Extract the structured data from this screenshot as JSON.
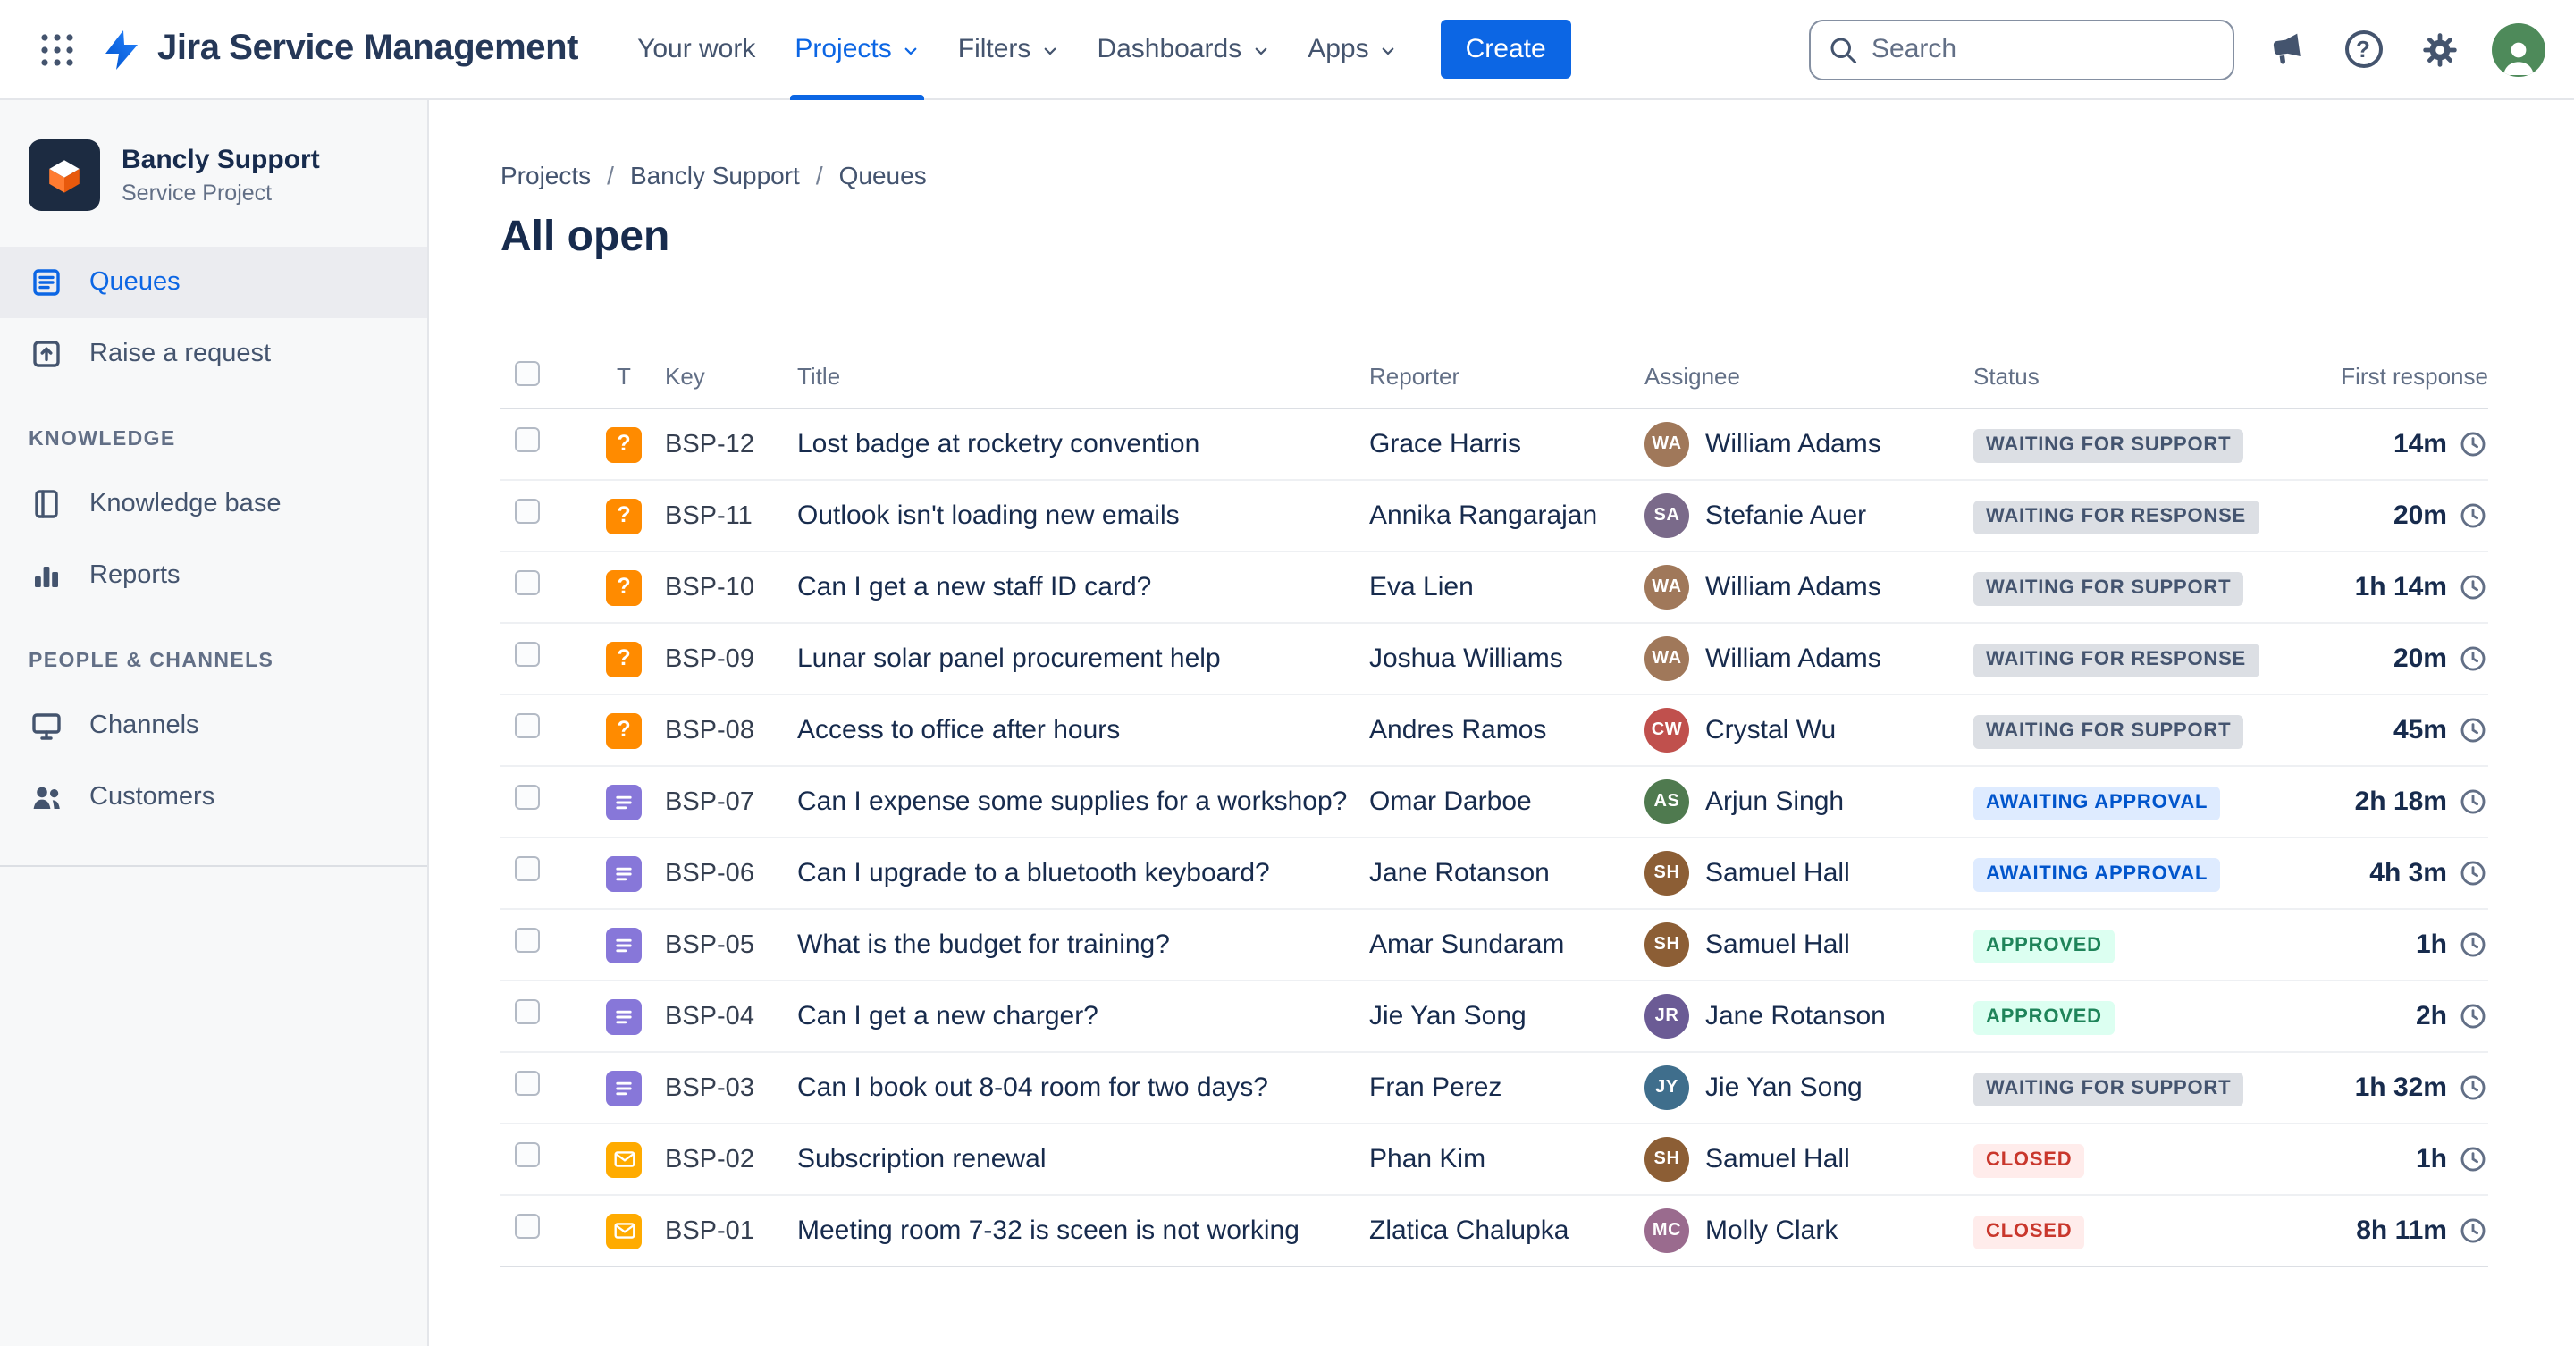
{
  "nav": {
    "app_name": "Jira Service Management",
    "items": [
      {
        "label": "Your work",
        "chevron": false,
        "active": false
      },
      {
        "label": "Projects",
        "chevron": true,
        "active": true
      },
      {
        "label": "Filters",
        "chevron": true,
        "active": false
      },
      {
        "label": "Dashboards",
        "chevron": true,
        "active": false
      },
      {
        "label": "Apps",
        "chevron": true,
        "active": false
      }
    ],
    "create_label": "Create",
    "search_placeholder": "Search",
    "help_glyph": "?"
  },
  "sidebar": {
    "project_name": "Bancly Support",
    "project_type": "Service Project",
    "menu": [
      {
        "label": "Queues",
        "active": true
      },
      {
        "label": "Raise a request",
        "active": false
      }
    ],
    "sections": [
      {
        "label": "KNOWLEDGE",
        "items": [
          {
            "label": "Knowledge base"
          },
          {
            "label": "Reports"
          }
        ]
      },
      {
        "label": "PEOPLE & CHANNELS",
        "items": [
          {
            "label": "Channels"
          },
          {
            "label": "Customers"
          }
        ]
      }
    ]
  },
  "breadcrumb": {
    "items": [
      "Projects",
      "Bancly Support",
      "Queues"
    ],
    "separator": "/"
  },
  "page_title": "All open",
  "table": {
    "columns": {
      "type": "T",
      "key": "Key",
      "title": "Title",
      "reporter": "Reporter",
      "assignee": "Assignee",
      "status": "Status",
      "first_response": "First response"
    },
    "rows": [
      {
        "key": "BSP-12",
        "type": "question",
        "title": "Lost badge at rocketry convention",
        "reporter": "Grace Harris",
        "assignee": "William Adams",
        "avatar_color": "#A0785A",
        "status": "WAITING FOR SUPPORT",
        "status_kind": "neutral",
        "first_response": "14m"
      },
      {
        "key": "BSP-11",
        "type": "question",
        "title": "Outlook isn't loading new emails",
        "reporter": "Annika Rangarajan",
        "assignee": "Stefanie Auer",
        "avatar_color": "#7A6A8A",
        "status": "WAITING FOR RESPONSE",
        "status_kind": "neutral",
        "first_response": "20m"
      },
      {
        "key": "BSP-10",
        "type": "question",
        "title": "Can I get a new staff ID card?",
        "reporter": "Eva Lien",
        "assignee": "William Adams",
        "avatar_color": "#A0785A",
        "status": "WAITING FOR SUPPORT",
        "status_kind": "neutral",
        "first_response": "1h 14m"
      },
      {
        "key": "BSP-09",
        "type": "question",
        "title": "Lunar solar panel procurement help",
        "reporter": "Joshua Williams",
        "assignee": "William Adams",
        "avatar_color": "#A0785A",
        "status": "WAITING FOR RESPONSE",
        "status_kind": "neutral",
        "first_response": "20m"
      },
      {
        "key": "BSP-08",
        "type": "question",
        "title": "Access to office after hours",
        "reporter": "Andres Ramos",
        "assignee": "Crystal Wu",
        "avatar_color": "#C0504D",
        "status": "WAITING FOR SUPPORT",
        "status_kind": "neutral",
        "first_response": "45m"
      },
      {
        "key": "BSP-07",
        "type": "request",
        "title": "Can I expense some supplies for a workshop?",
        "reporter": "Omar Darboe",
        "assignee": "Arjun Singh",
        "avatar_color": "#4F7A4F",
        "status": "AWAITING APPROVAL",
        "status_kind": "info",
        "first_response": "2h 18m"
      },
      {
        "key": "BSP-06",
        "type": "request",
        "title": "Can I upgrade to a bluetooth keyboard?",
        "reporter": "Jane Rotanson",
        "assignee": "Samuel Hall",
        "avatar_color": "#8C5E35",
        "status": "AWAITING APPROVAL",
        "status_kind": "info",
        "first_response": "4h 3m"
      },
      {
        "key": "BSP-05",
        "type": "request",
        "title": "What is the budget for training?",
        "reporter": "Amar Sundaram",
        "assignee": "Samuel Hall",
        "avatar_color": "#8C5E35",
        "status": "APPROVED",
        "status_kind": "success",
        "first_response": "1h"
      },
      {
        "key": "BSP-04",
        "type": "request",
        "title": "Can I get a new charger?",
        "reporter": "Jie Yan Song",
        "assignee": "Jane Rotanson",
        "avatar_color": "#6B5B95",
        "status": "APPROVED",
        "status_kind": "success",
        "first_response": "2h"
      },
      {
        "key": "BSP-03",
        "type": "request",
        "title": "Can I book out 8-04 room for two days?",
        "reporter": "Fran Perez",
        "assignee": "Jie Yan Song",
        "avatar_color": "#3F6E8C",
        "status": "WAITING FOR SUPPORT",
        "status_kind": "neutral",
        "first_response": "1h 32m"
      },
      {
        "key": "BSP-02",
        "type": "email",
        "title": "Subscription renewal",
        "reporter": "Phan Kim",
        "assignee": "Samuel Hall",
        "avatar_color": "#8C5E35",
        "status": "CLOSED",
        "status_kind": "danger",
        "first_response": "1h"
      },
      {
        "key": "BSP-01",
        "type": "email",
        "title": "Meeting room 7-32 is sceen is not working",
        "reporter": "Zlatica Chalupka",
        "assignee": "Molly Clark",
        "avatar_color": "#9A6B8E",
        "status": "CLOSED",
        "status_kind": "danger",
        "first_response": "8h 11m"
      }
    ]
  },
  "status_styles": {
    "neutral": {
      "bg": "#DCDFE4",
      "fg": "#44546F"
    },
    "info": {
      "bg": "#DEEBFF",
      "fg": "#0055CC"
    },
    "success": {
      "bg": "#DCFFF1",
      "fg": "#1F845A"
    },
    "danger": {
      "bg": "#FFECEB",
      "fg": "#C9372C"
    }
  },
  "type_colors": {
    "question": "#FF8B00",
    "request": "#8777D9",
    "email": "#FFAB00"
  },
  "accent_color": "#0C66E4"
}
